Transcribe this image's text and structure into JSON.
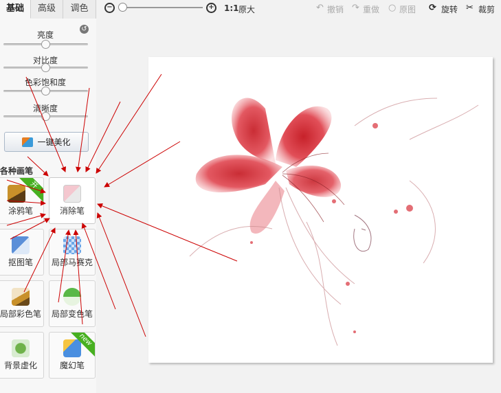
{
  "tabs": [
    {
      "label": "基础",
      "active": true
    },
    {
      "label": "高级",
      "active": false
    },
    {
      "label": "调色",
      "active": false
    }
  ],
  "sliders": [
    {
      "label": "亮度",
      "value": 0.5
    },
    {
      "label": "对比度",
      "value": 0.5
    },
    {
      "label": "色彩饱和度",
      "value": 0.5
    },
    {
      "label": "清晰度",
      "value": 0.5
    }
  ],
  "one_click_label": "一键美化",
  "brush_section_title": "各种画笔",
  "tools": [
    {
      "label": "涂鸦笔",
      "icon": "brush-icon",
      "badge": "开"
    },
    {
      "label": "消除笔",
      "icon": "eraser-icon",
      "selected": true
    },
    {
      "label": "抠图笔",
      "icon": "cutout-pen-icon"
    },
    {
      "label": "局部马赛克",
      "icon": "mosaic-icon"
    },
    {
      "label": "局部彩色笔",
      "icon": "color-brush-icon"
    },
    {
      "label": "局部变色笔",
      "icon": "recolor-pen-icon"
    },
    {
      "label": "背景虚化",
      "icon": "blur-background-icon"
    },
    {
      "label": "魔幻笔",
      "icon": "magic-pen-icon",
      "badge": "new"
    }
  ],
  "toolbar": {
    "actual_size": "1:1",
    "original_size": "原大",
    "undo": "撤销",
    "redo": "重做",
    "original": "原图",
    "rotate": "旋转",
    "crop": "裁剪",
    "zoom_level": 0.0
  },
  "colors": {
    "flower_red": "#d8313b",
    "arrow_red": "#cc0000",
    "badge_green": "#47b020"
  }
}
